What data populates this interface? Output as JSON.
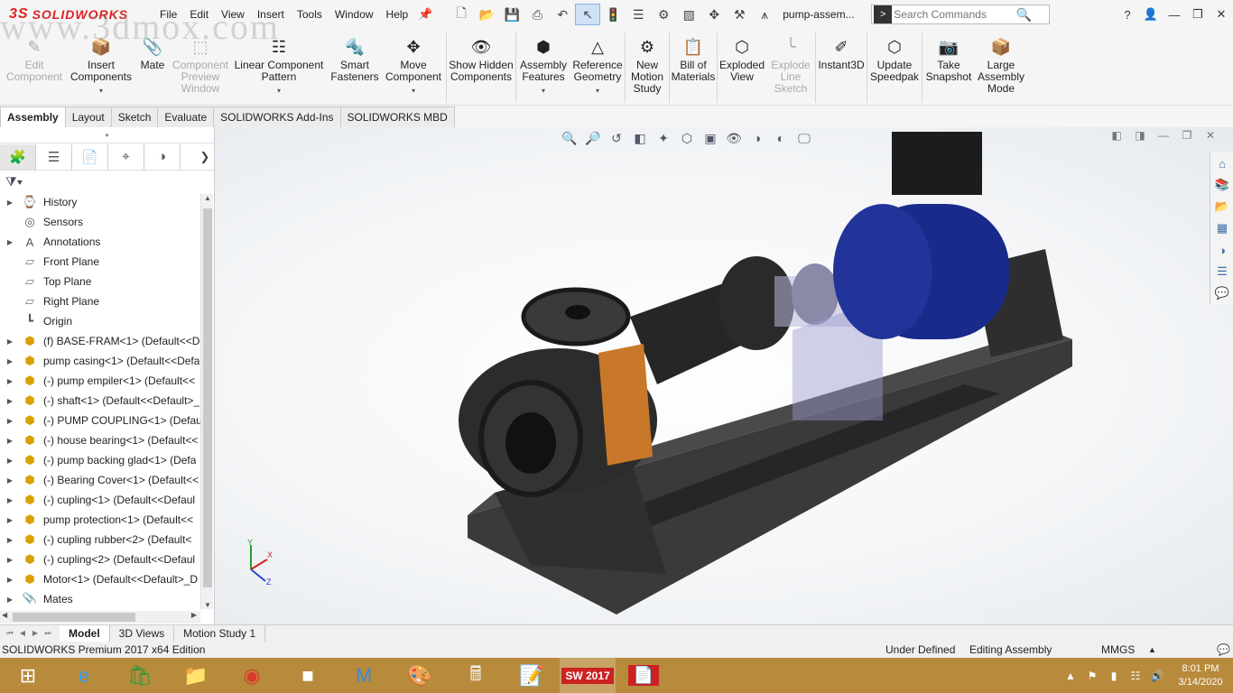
{
  "app": {
    "brand": "SOLIDWORKS",
    "document_title": "pump-assem...",
    "watermark": "www.3dmox.com"
  },
  "menubar": [
    "File",
    "Edit",
    "View",
    "Insert",
    "Tools",
    "Window",
    "Help"
  ],
  "search": {
    "placeholder": "Search Commands"
  },
  "ribbon": [
    {
      "label": "Edit Component",
      "icon": "edit-component-icon",
      "enabled": false
    },
    {
      "label": "Insert Components",
      "icon": "insert-components-icon",
      "enabled": true
    },
    {
      "label": "Mate",
      "icon": "mate-icon",
      "enabled": true
    },
    {
      "label": "Component Preview Window",
      "icon": "component-preview-icon",
      "enabled": false
    },
    {
      "label": "Linear Component Pattern",
      "icon": "linear-pattern-icon",
      "enabled": true
    },
    {
      "label": "Smart Fasteners",
      "icon": "smart-fasteners-icon",
      "enabled": true
    },
    {
      "label": "Move Component",
      "icon": "move-component-icon",
      "enabled": true
    },
    {
      "label": "Show Hidden Components",
      "icon": "show-hidden-icon",
      "enabled": true
    },
    {
      "label": "Assembly Features",
      "icon": "assembly-features-icon",
      "enabled": true
    },
    {
      "label": "Reference Geometry",
      "icon": "reference-geometry-icon",
      "enabled": true
    },
    {
      "label": "New Motion Study",
      "icon": "motion-study-icon",
      "enabled": true
    },
    {
      "label": "Bill of Materials",
      "icon": "bom-icon",
      "enabled": true
    },
    {
      "label": "Exploded View",
      "icon": "exploded-view-icon",
      "enabled": true
    },
    {
      "label": "Explode Line Sketch",
      "icon": "explode-line-icon",
      "enabled": false
    },
    {
      "label": "Instant3D",
      "icon": "instant3d-icon",
      "enabled": true
    },
    {
      "label": "Update Speedpak",
      "icon": "speedpak-icon",
      "enabled": true
    },
    {
      "label": "Take Snapshot",
      "icon": "camera-icon",
      "enabled": true
    },
    {
      "label": "Large Assembly Mode",
      "icon": "large-assembly-icon",
      "enabled": true
    }
  ],
  "command_tabs": [
    "Assembly",
    "Layout",
    "Sketch",
    "Evaluate",
    "SOLIDWORKS Add-Ins",
    "SOLIDWORKS MBD"
  ],
  "feature_tree": [
    {
      "label": "History",
      "icon": "history-icon",
      "expandable": true
    },
    {
      "label": "Sensors",
      "icon": "sensors-icon",
      "expandable": false
    },
    {
      "label": "Annotations",
      "icon": "annotations-icon",
      "expandable": true
    },
    {
      "label": "Front Plane",
      "icon": "plane-icon",
      "expandable": false
    },
    {
      "label": "Top Plane",
      "icon": "plane-icon",
      "expandable": false
    },
    {
      "label": "Right Plane",
      "icon": "plane-icon",
      "expandable": false
    },
    {
      "label": "Origin",
      "icon": "origin-icon",
      "expandable": false
    },
    {
      "label": "(f) BASE-FRAM<1> (Default<<De",
      "icon": "part-icon",
      "expandable": true
    },
    {
      "label": "pump casing<1> (Default<<Defa",
      "icon": "part-icon",
      "expandable": true
    },
    {
      "label": "(-) pump empiler<1> (Default<<",
      "icon": "part-icon",
      "expandable": true
    },
    {
      "label": "(-) shaft<1> (Default<<Default>_",
      "icon": "part-icon",
      "expandable": true
    },
    {
      "label": "(-) PUMP COUPLING<1> (Defaul",
      "icon": "part-icon",
      "expandable": true
    },
    {
      "label": "(-) house bearing<1> (Default<<",
      "icon": "part-icon",
      "expandable": true
    },
    {
      "label": "(-) pump backing glad<1> (Defa",
      "icon": "part-icon",
      "expandable": true
    },
    {
      "label": "(-) Bearing Cover<1> (Default<<",
      "icon": "part-icon",
      "expandable": true
    },
    {
      "label": "(-) cupling<1> (Default<<Defaul",
      "icon": "part-icon",
      "expandable": true
    },
    {
      "label": "pump protection<1> (Default<<",
      "icon": "part-icon",
      "expandable": true
    },
    {
      "label": "(-) cupling rubber<2> (Default<",
      "icon": "part-icon",
      "expandable": true
    },
    {
      "label": "(-) cupling<2> (Default<<Defaul",
      "icon": "part-icon",
      "expandable": true
    },
    {
      "label": "Motor<1> (Default<<Default>_D",
      "icon": "part-icon",
      "expandable": true
    },
    {
      "label": "Mates",
      "icon": "mates-icon",
      "expandable": true
    }
  ],
  "bottom_tabs": [
    "Model",
    "3D Views",
    "Motion Study 1"
  ],
  "status": {
    "edition": "SOLIDWORKS Premium 2017 x64 Edition",
    "definition": "Under Defined",
    "mode": "Editing Assembly",
    "units": "MMGS"
  },
  "triad": {
    "x": "X",
    "y": "Y",
    "z": "Z"
  },
  "taskbar": {
    "apps": [
      "start-icon",
      "ie-icon",
      "store-icon",
      "explorer-icon",
      "chrome-icon",
      "3ds-max-icon",
      "maya-icon",
      "paint-icon",
      "calculator-icon",
      "notes-icon",
      "solidworks-icon",
      "pdf-icon"
    ],
    "sw_badge": "2017",
    "time": "8:01 PM",
    "date": "3/14/2020"
  },
  "colors": {
    "accent": "#d22a2a",
    "motor": "#1a2a8a",
    "taskbar": "#b88a3b"
  }
}
